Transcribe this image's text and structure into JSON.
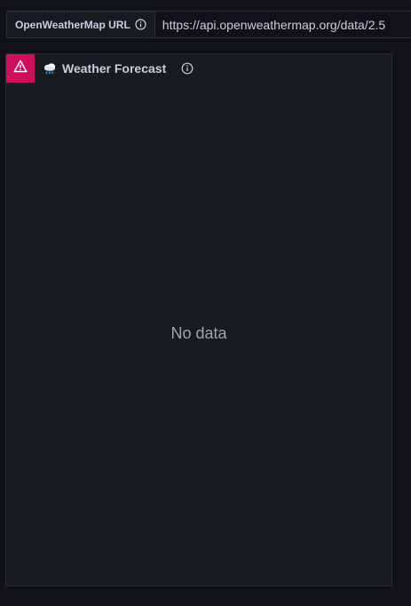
{
  "variable": {
    "label": "OpenWeatherMap URL",
    "value": "https://api.openweathermap.org/data/2.5"
  },
  "panel": {
    "title": "Weather Forecast",
    "title_emoji": "cloud-with-rain-icon",
    "status": "error",
    "message": "No data"
  },
  "colors": {
    "background": "#111217",
    "panel": "#181b1f",
    "border": "#2c3036",
    "error": "#d10e5c",
    "text": "#ccccdc",
    "muted": "#a0a4ad"
  }
}
